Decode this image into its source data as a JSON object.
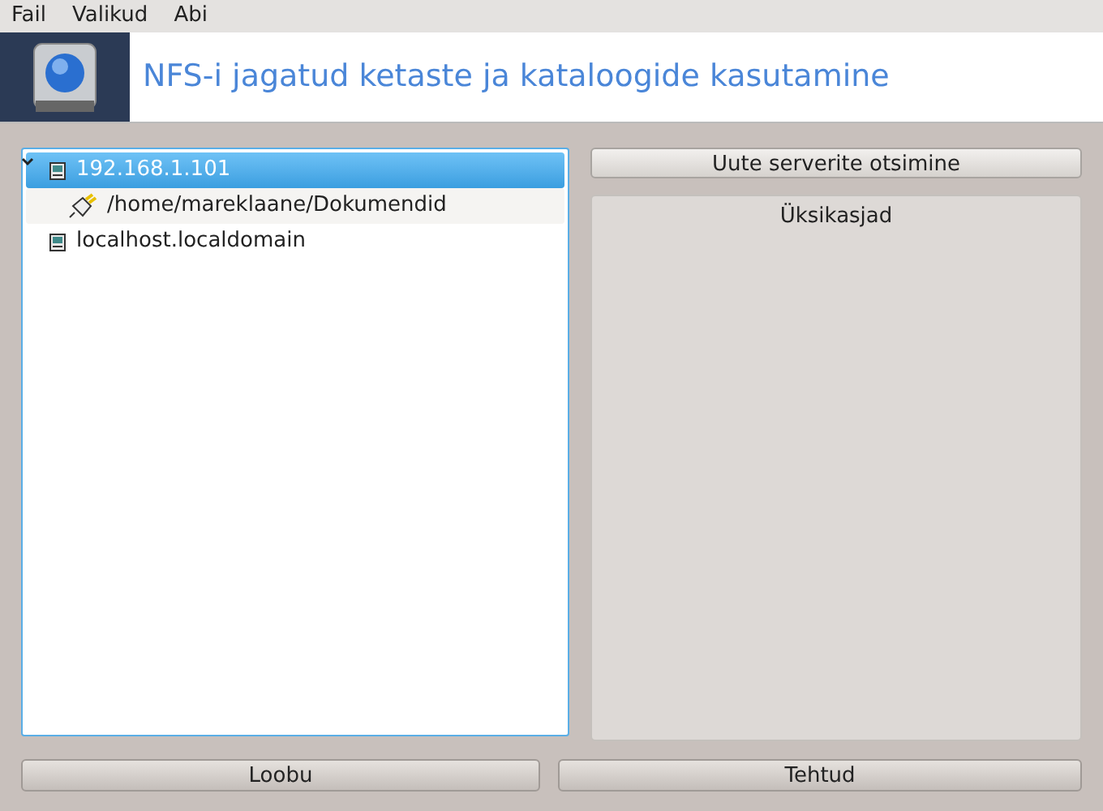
{
  "menu": [
    "Fail",
    "Valikud",
    "Abi"
  ],
  "header": {
    "title": "NFS-i jagatud ketaste ja kataloogide kasutamine"
  },
  "tree": [
    {
      "label": "192.168.1.101",
      "kind": "server",
      "selected": true,
      "expanded": true,
      "children": [
        {
          "label": "/home/mareklaane/Dokumendid",
          "kind": "share",
          "selected": false
        }
      ]
    },
    {
      "label": "localhost.localdomain",
      "kind": "server",
      "selected": false
    }
  ],
  "search_button": "Uute serverite otsimine",
  "mountpoints": {
    "title": "Üksikasjad"
  },
  "buttons": [
    "Loobu",
    "Tehtud"
  ]
}
